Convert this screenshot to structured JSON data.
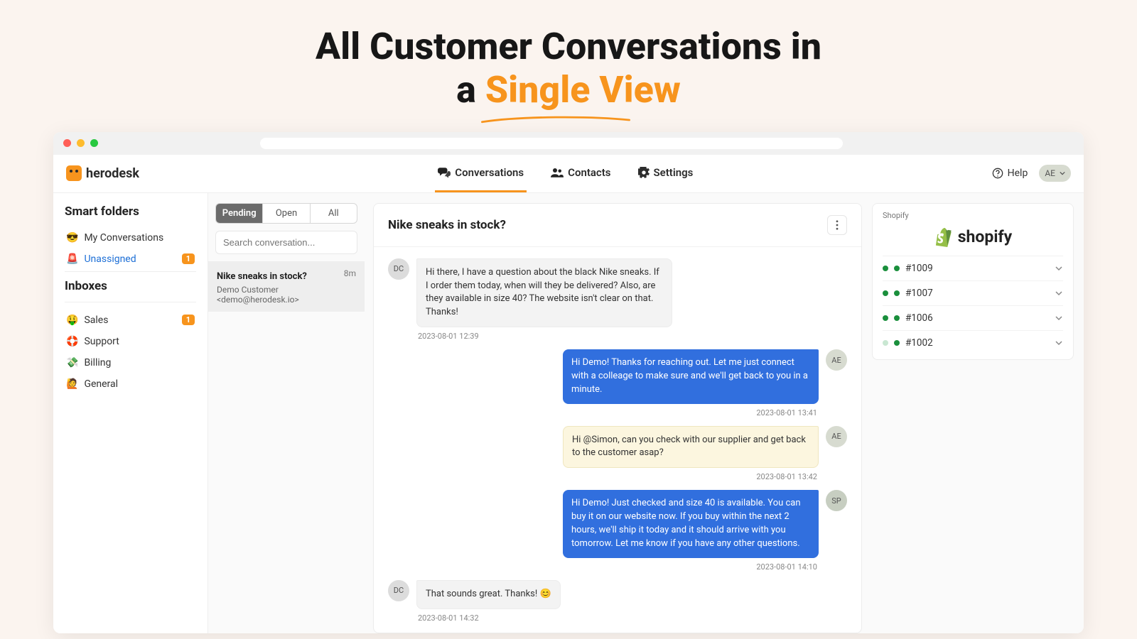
{
  "hero": {
    "line1": "All Customer Conversations in",
    "line2_pre": "a ",
    "line2_accent": "Single View"
  },
  "brand": "herodesk",
  "nav": {
    "conversations": "Conversations",
    "contacts": "Contacts",
    "settings": "Settings"
  },
  "help": "Help",
  "user_initials": "AE",
  "sidebar": {
    "smart_folders_title": "Smart folders",
    "my_conversations": "My Conversations",
    "unassigned": "Unassigned",
    "unassigned_count": "1",
    "inboxes_title": "Inboxes",
    "sales": "Sales",
    "sales_count": "1",
    "support": "Support",
    "billing": "Billing",
    "general": "General"
  },
  "tabs": {
    "pending": "Pending",
    "open": "Open",
    "all": "All"
  },
  "search_placeholder": "Search conversation...",
  "conv_item": {
    "title": "Nike sneaks in stock?",
    "time": "8m",
    "sub": "Demo Customer <demo@herodesk.io>"
  },
  "thread_title": "Nike sneaks in stock?",
  "avatars": {
    "dc": "DC",
    "ae": "AE",
    "sp": "SP"
  },
  "messages": {
    "m1": "Hi there, I have a question about the black Nike sneaks. If I order them today, when will they be delivered? Also, are they available in size 40? The website isn't clear on that. Thanks!",
    "t1": "2023-08-01 12:39",
    "m2": "Hi Demo! Thanks for reaching out. Let me just connect with a colleage to make sure and we'll get back to you in a minute.",
    "t2": "2023-08-01 13:41",
    "m3": "Hi @Simon, can you check with our supplier and get back to the customer asap?",
    "t3": "2023-08-01 13:42",
    "m4": "Hi Demo! Just checked and size 40 is available. You can buy it on our website now. If you buy within the next 2 hours, we'll ship it today and it should arrive with you tomorrow. Let me know if you have any other questions.",
    "t4": "2023-08-01 14:10",
    "m5": "That sounds great. Thanks! 😊",
    "t5": "2023-08-01 14:32"
  },
  "panel": {
    "label": "Shopify",
    "brand": "shopify",
    "orders": [
      {
        "id": "#1009",
        "status": "paid"
      },
      {
        "id": "#1007",
        "status": "paid"
      },
      {
        "id": "#1006",
        "status": "paid"
      },
      {
        "id": "#1002",
        "status": "partial"
      }
    ]
  }
}
